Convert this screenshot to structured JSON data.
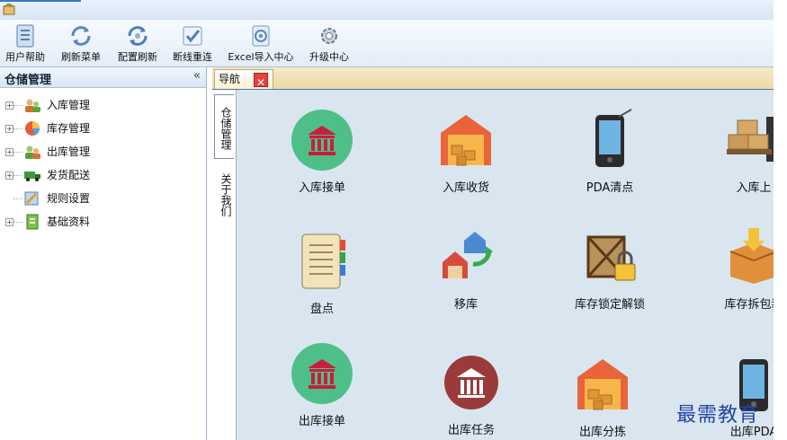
{
  "toolbar": {
    "buttons": [
      {
        "label": "用户帮助",
        "icon": "document-list-icon"
      },
      {
        "label": "刷新菜单",
        "icon": "refresh-icon"
      },
      {
        "label": "配置刷新",
        "icon": "refresh-config-icon"
      },
      {
        "label": "断线重连",
        "icon": "checkmark-icon"
      },
      {
        "label": "Excel导入中心",
        "icon": "import-icon"
      },
      {
        "label": "升级中心",
        "icon": "gear-icon"
      }
    ]
  },
  "left_panel": {
    "title": "仓储管理",
    "collapse": "«",
    "tree": [
      {
        "label": "入库管理",
        "expandable": true,
        "icon": "inbound-users-icon"
      },
      {
        "label": "库存管理",
        "expandable": true,
        "icon": "pie-chart-icon"
      },
      {
        "label": "出库管理",
        "expandable": true,
        "icon": "outbound-users-icon"
      },
      {
        "label": "发货配送",
        "expandable": true,
        "icon": "truck-icon"
      },
      {
        "label": "规则设置",
        "expandable": false,
        "icon": "rule-settings-icon"
      },
      {
        "label": "基础资料",
        "expandable": true,
        "icon": "basic-data-icon"
      }
    ]
  },
  "tabs": {
    "nav_label": "导航",
    "close_glyph": "✕",
    "vertical": [
      "仓储管理",
      "关于我们"
    ]
  },
  "tiles": [
    {
      "label": "入库接单",
      "icon": "bank-green-icon"
    },
    {
      "label": "入库收货",
      "icon": "warehouse-icon"
    },
    {
      "label": "PDA清点",
      "icon": "pda-icon"
    },
    {
      "label": "入库上",
      "icon": "forklift-boxes-icon"
    },
    {
      "label": "盘点",
      "icon": "notebook-icon"
    },
    {
      "label": "移库",
      "icon": "move-houses-icon"
    },
    {
      "label": "库存锁定解锁",
      "icon": "crate-lock-icon"
    },
    {
      "label": "库存拆包装",
      "icon": "open-box-icon"
    },
    {
      "label": "出库接单",
      "icon": "bank-green-icon"
    },
    {
      "label": "出库任务",
      "icon": "bank-red-icon"
    },
    {
      "label": "出库分拣",
      "icon": "warehouse-icon"
    },
    {
      "label": "出库PDA",
      "icon": "pda-icon"
    }
  ],
  "watermark": "最需教育",
  "colors": {
    "tile_bg": "#d9e6ef",
    "accent_blue": "#4a74b4",
    "close_red": "#e9403d"
  }
}
